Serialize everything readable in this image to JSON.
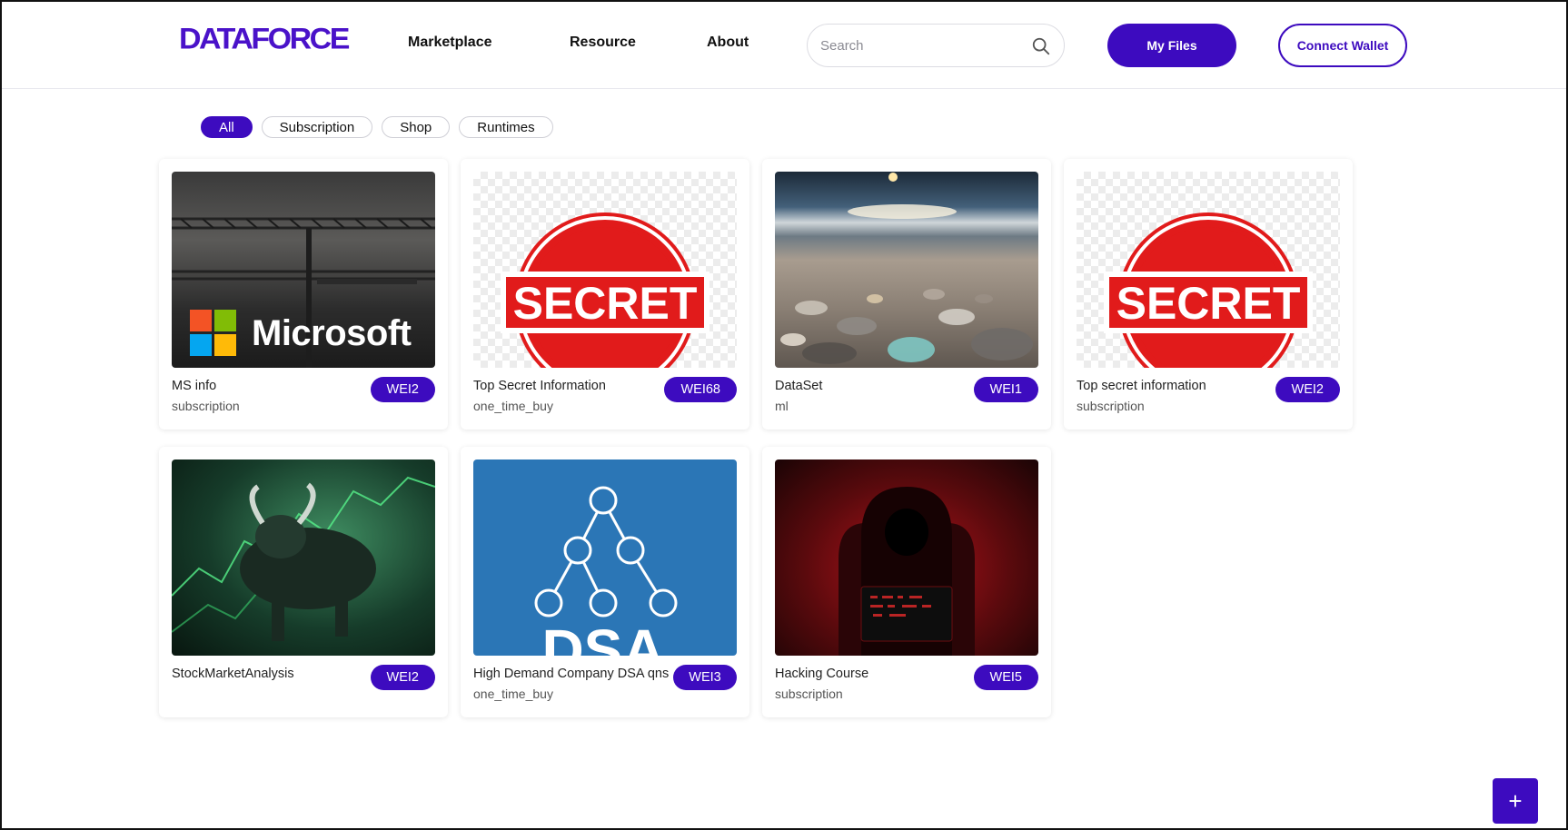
{
  "header": {
    "logo": "DATAFORCE",
    "nav": [
      "Marketplace",
      "Resource",
      "About"
    ],
    "search_placeholder": "Search",
    "my_files_label": "My Files",
    "connect_wallet_label": "Connect Wallet"
  },
  "filters": [
    "All",
    "Subscription",
    "Shop",
    "Runtimes"
  ],
  "active_filter": "All",
  "cards": [
    {
      "title": "MS info",
      "type": "subscription",
      "price": "WEI2",
      "image": "microsoft-logo-image"
    },
    {
      "title": "Top Secret Information",
      "type": "one_time_buy",
      "price": "WEI68",
      "image": "secret-stamp-image",
      "stamp": "SECRET"
    },
    {
      "title": "DataSet",
      "type": "ml",
      "price": "WEI1",
      "image": "beach-pebbles-image"
    },
    {
      "title": "Top secret information",
      "type": "subscription",
      "price": "WEI2",
      "image": "secret-stamp-image",
      "stamp": "SECRET"
    },
    {
      "title": "StockMarketAnalysis",
      "type": "",
      "price": "WEI2",
      "image": "bull-market-image"
    },
    {
      "title": "High Demand Company DSA qns",
      "type": "one_time_buy",
      "price": "WEI3",
      "image": "dsa-tree-image",
      "stamp": "DSA"
    },
    {
      "title": "Hacking Course",
      "type": "subscription",
      "price": "WEI5",
      "image": "hackers-image"
    }
  ],
  "microsoft_text": "Microsoft",
  "fab_label": "+",
  "colors": {
    "accent": "#3d0bbf",
    "stamp_red": "#e11b1b"
  }
}
